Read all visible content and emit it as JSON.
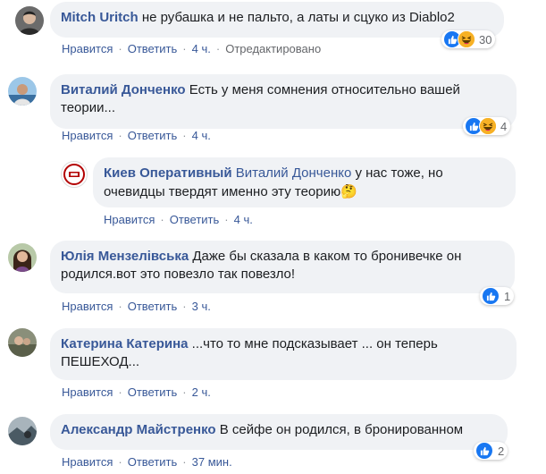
{
  "comments": [
    {
      "author": "Mitch Uritch",
      "text": "не рубашка и не пальто, а латы и сцуко из Diablo2",
      "actions": [
        "Нравится",
        "Ответить"
      ],
      "time": "4 ч.",
      "edited": "Отредактировано",
      "reaction_count": "30",
      "reactions": [
        "like-icon",
        "haha-icon"
      ]
    },
    {
      "author": "Виталий Донченко",
      "text": "Есть у меня сомнения относительно вашей теории...",
      "actions": [
        "Нравится",
        "Ответить"
      ],
      "time": "4 ч.",
      "reaction_count": "4",
      "reactions": [
        "like-icon",
        "haha-icon"
      ]
    },
    {
      "author": "Киев Оперативный",
      "mention": "Виталий Донченко",
      "text": "у нас тоже, но очевидцы твердят именно эту теорию",
      "emoji": "🤔",
      "actions": [
        "Нравится",
        "Ответить"
      ],
      "time": "4 ч."
    },
    {
      "author": "Юлія Мензелівська",
      "text": "Даже бы сказала в каком то бронивечке он родился.вот это повезло так повезло!",
      "actions": [
        "Нравится",
        "Ответить"
      ],
      "time": "3 ч.",
      "reaction_count": "1",
      "reactions": [
        "like-icon"
      ]
    },
    {
      "author": "Катерина Катерина",
      "text": "...что то мне подсказывает ... он теперь ПЕШЕХОД...",
      "actions": [
        "Нравится",
        "Ответить"
      ],
      "time": "2 ч."
    },
    {
      "author": "Александр Майстренко",
      "text": "В сейфе он родился, в бронированном",
      "actions": [
        "Нравится",
        "Ответить"
      ],
      "time": "37 мин.",
      "reaction_count": "2",
      "reactions": [
        "like-icon"
      ]
    }
  ],
  "colors": {
    "bubble": "#f0f2f5",
    "link": "#385898",
    "meta": "#65676b",
    "like": "#1877f2",
    "haha": "#f7b125"
  }
}
